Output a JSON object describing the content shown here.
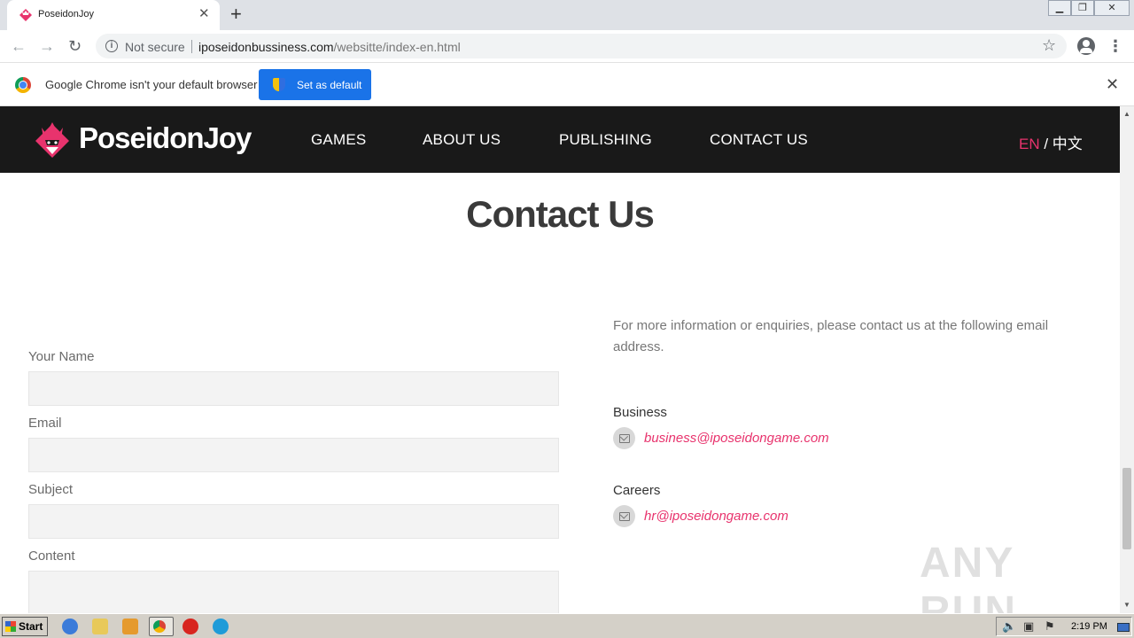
{
  "browser": {
    "tab_title": "PoseidonJoy",
    "url_host": "iposeidonbussiness.com",
    "url_path": "/websitte/index-en.html",
    "security_label": "Not secure",
    "infobar_message": "Google Chrome isn't your default browser",
    "set_default_label": "Set as default"
  },
  "site": {
    "logo_text": "PoseidonJoy",
    "nav": [
      "GAMES",
      "ABOUT US",
      "PUBLISHING",
      "CONTACT US"
    ],
    "lang_en": "EN",
    "lang_sep": " / ",
    "lang_zh": "中文",
    "brand_color": "#e8336d"
  },
  "page": {
    "title": "Contact Us",
    "form": {
      "name_label": "Your Name",
      "email_label": "Email",
      "subject_label": "Subject",
      "content_label": "Content"
    },
    "contact": {
      "intro": "For more information or enquiries, please contact us at the following email address.",
      "business_heading": "Business",
      "business_email": "business@iposeidongame.com",
      "careers_heading": "Careers",
      "careers_email": "hr@iposeidongame.com"
    }
  },
  "watermark": "ANY RUN",
  "taskbar": {
    "start_label": "Start",
    "clock": "2:19 PM"
  }
}
